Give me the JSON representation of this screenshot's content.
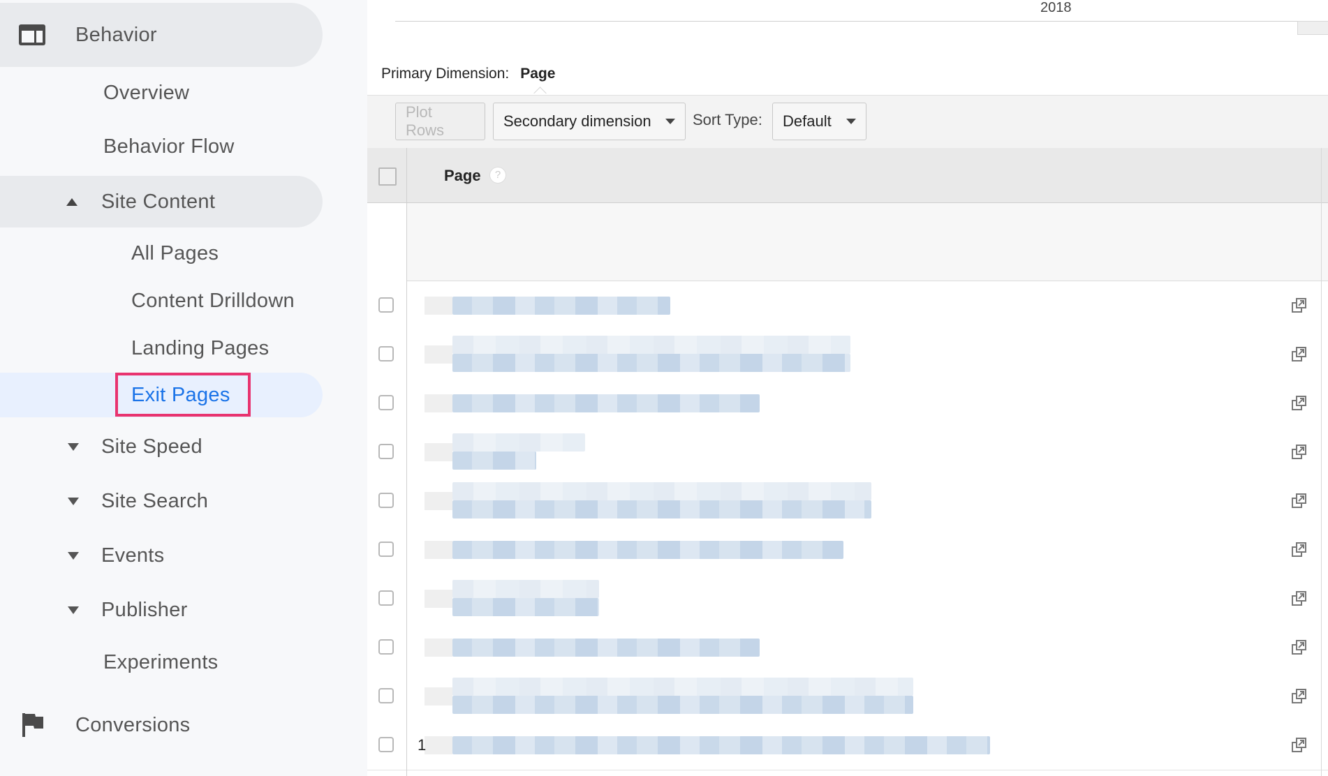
{
  "sidebar": {
    "behavior": "Behavior",
    "overview": "Overview",
    "behavior_flow": "Behavior Flow",
    "site_content": "Site Content",
    "all_pages": "All Pages",
    "content_drilldown": "Content Drilldown",
    "landing_pages": "Landing Pages",
    "exit_pages": "Exit Pages",
    "site_speed": "Site Speed",
    "site_search": "Site Search",
    "events": "Events",
    "publisher": "Publisher",
    "experiments": "Experiments",
    "conversions": "Conversions"
  },
  "chart": {
    "year_label": "2018"
  },
  "primary_dimension": {
    "label": "Primary Dimension:",
    "value": "Page"
  },
  "toolbar": {
    "plot_rows": "Plot Rows",
    "secondary_dimension": "Secondary dimension",
    "sort_type_label": "Sort Type:",
    "sort_type_value": "Default"
  },
  "table": {
    "column_header": "Page",
    "help_icon": "?",
    "last_row_index": "1"
  },
  "colors": {
    "active_link": "#1a73e8",
    "highlight_border": "#e8336f"
  },
  "icons": [
    "behavior-icon",
    "caret-up-icon",
    "caret-down-icon",
    "flag-icon",
    "help-icon",
    "external-link-icon",
    "dropdown-arrow-icon"
  ]
}
